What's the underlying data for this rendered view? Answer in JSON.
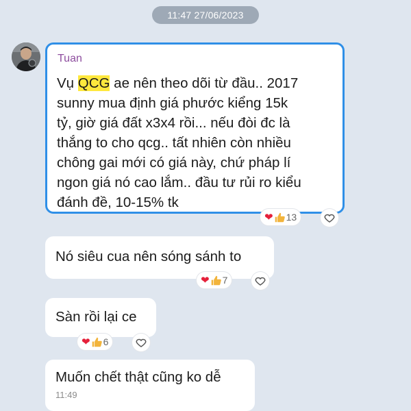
{
  "header": {
    "timestamp": "11:47 27/06/2023"
  },
  "messages": [
    {
      "sender": "Tuan",
      "text_highlight": "QCG",
      "text_before": "Vụ ",
      "text_after": " ae nên theo dõi từ đầu.. 2017\nsunny mua định giá phước kiểng 15k\ntỷ, giờ giá đất x3x4 rồi... nếu đòi đc là\nthắng to cho qcg.. tất nhiên còn nhiều\nchông gai mới có giá này, chứ pháp lí\nngon giá nó cao lắm.. đầu tư rủi ro kiểu\nđánh  đề, 10-15% tk",
      "reaction_count": "13"
    },
    {
      "text": "Nó siêu cua nên sóng sánh to",
      "reaction_count": "7"
    },
    {
      "text": "Sàn rồi lại ce",
      "reaction_count": "6"
    },
    {
      "text": "Muốn chết thật cũng ko dễ",
      "time": "11:49"
    }
  ],
  "icons": {
    "reaction_heart": "heart-icon",
    "reaction_like": "thumbs-up-icon",
    "like_button": "heart-outline-icon"
  },
  "colors": {
    "highlight_border": "#2f8fe7",
    "sender_name": "#8d4d9e",
    "text_highlight": "#ffe83d",
    "background": "#dfe6ef"
  }
}
